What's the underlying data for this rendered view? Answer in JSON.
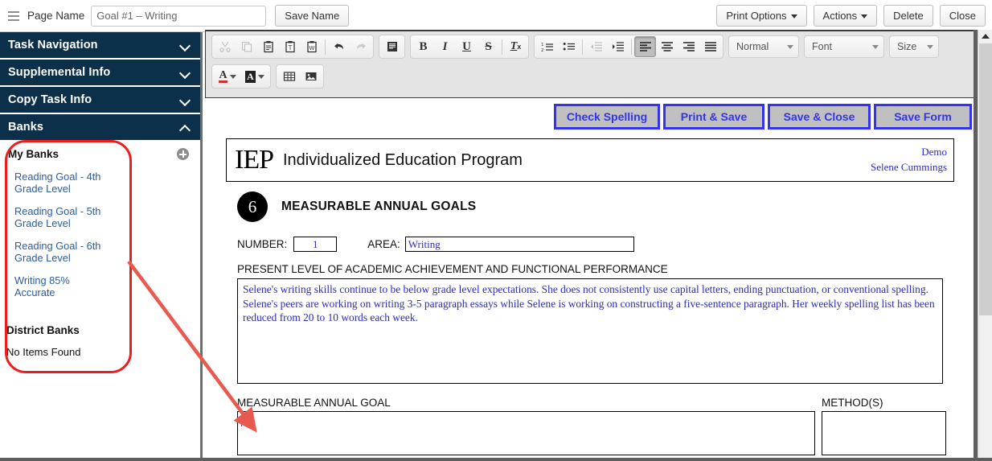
{
  "topbar": {
    "menu_icon": "hamburger-icon",
    "page_name_label": "Page Name",
    "page_name_value": "Goal #1 – Writing",
    "page_name_placeholder": "Page Name",
    "save_name_label": "Save Name",
    "print_options_label": "Print Options",
    "actions_label": "Actions",
    "delete_label": "Delete",
    "close_label": "Close"
  },
  "sidebar": {
    "sections": [
      {
        "label": "Task Navigation",
        "state": "collapsed",
        "icon": "chevron-down-icon"
      },
      {
        "label": "Supplemental Info",
        "state": "collapsed",
        "icon": "chevron-down-icon"
      },
      {
        "label": "Copy Task Info",
        "state": "collapsed",
        "icon": "chevron-down-icon"
      },
      {
        "label": "Banks",
        "state": "expanded",
        "icon": "chevron-up-icon"
      }
    ],
    "banks": {
      "my_banks_title": "My Banks",
      "add_icon": "plus-circle-icon",
      "items": [
        "Reading Goal - 4th Grade Level",
        "Reading Goal - 5th Grade Level",
        "Reading Goal - 6th Grade Level",
        "Writing 85% Accurate"
      ],
      "district_banks_title": "District Banks",
      "district_banks_empty": "No Items Found"
    }
  },
  "editor_toolbar": {
    "groups": [
      {
        "name": "clipboard",
        "buttons": [
          {
            "icon": "cut-icon",
            "label": "Cut",
            "disabled": true
          },
          {
            "icon": "copy-icon",
            "label": "Copy",
            "disabled": true
          },
          {
            "icon": "paste-icon",
            "label": "Paste",
            "disabled": false
          },
          {
            "icon": "paste-text-icon",
            "label": "Paste as plain text",
            "disabled": false
          },
          {
            "icon": "paste-word-icon",
            "label": "Paste from Word",
            "disabled": false
          },
          {
            "icon": "undo-icon",
            "label": "Undo",
            "disabled": false
          },
          {
            "icon": "redo-icon",
            "label": "Redo",
            "disabled": true
          }
        ]
      },
      {
        "name": "templates",
        "buttons": [
          {
            "icon": "templates-icon",
            "label": "Templates",
            "disabled": false
          }
        ]
      },
      {
        "name": "basic-styles",
        "buttons": [
          {
            "icon": "bold-icon",
            "label": "B",
            "disabled": false
          },
          {
            "icon": "italic-icon",
            "label": "I",
            "disabled": false
          },
          {
            "icon": "underline-icon",
            "label": "U",
            "disabled": false
          },
          {
            "icon": "strikethrough-icon",
            "label": "S",
            "disabled": false
          },
          {
            "icon": "remove-format-icon",
            "label": "Tx",
            "disabled": false
          }
        ]
      },
      {
        "name": "paragraph",
        "buttons": [
          {
            "icon": "numbered-list-icon",
            "label": "Insert/Remove Numbered List",
            "disabled": false
          },
          {
            "icon": "bulleted-list-icon",
            "label": "Insert/Remove Bulleted List",
            "disabled": false
          },
          {
            "icon": "outdent-icon",
            "label": "Decrease Indent",
            "disabled": true
          },
          {
            "icon": "indent-icon",
            "label": "Increase Indent",
            "disabled": false
          },
          {
            "icon": "align-left-icon",
            "label": "Align Left",
            "disabled": false,
            "pressed": true
          },
          {
            "icon": "align-center-icon",
            "label": "Center",
            "disabled": false
          },
          {
            "icon": "align-right-icon",
            "label": "Align Right",
            "disabled": false
          },
          {
            "icon": "justify-icon",
            "label": "Justify",
            "disabled": false
          }
        ]
      }
    ],
    "selects": [
      {
        "name": "paragraph-format",
        "value": "Normal"
      },
      {
        "name": "font-family",
        "value": "Font"
      },
      {
        "name": "font-size",
        "value": "Size"
      }
    ],
    "row2": [
      {
        "icon": "text-color-icon",
        "label": "A",
        "has_caret": true
      },
      {
        "icon": "background-color-icon",
        "label": "A",
        "has_caret": true
      },
      {
        "icon": "table-icon",
        "label": "Table"
      },
      {
        "icon": "image-icon",
        "label": "Image"
      }
    ]
  },
  "actions": {
    "check_spelling": "Check Spelling",
    "print_save": "Print & Save",
    "save_close": "Save & Close",
    "save_form": "Save Form",
    "border_color": "#3333ee",
    "background_color": "#c0c0c0"
  },
  "document": {
    "logo_mark": "IEP",
    "header_title": "Individualized Education Program",
    "district": "Demo",
    "student_name": "Selene Cummings",
    "section_number": "6",
    "section_title": "MEASURABLE ANNUAL GOALS",
    "number_label": "NUMBER:",
    "number_value": "1",
    "area_label": "AREA:",
    "area_value": "Writing",
    "present_level_label": "PRESENT LEVEL OF ACADEMIC ACHIEVEMENT AND FUNCTIONAL PERFORMANCE",
    "present_level_text": "Selene's writing skills continue to be below grade level expectations. She does not consistently use capital letters, ending punctuation, or conventional spelling. Selene's peers are working on writing 3-5 paragraph essays while Selene is working on constructing a five-sentence paragraph. Her weekly spelling list has been reduced from 20 to 10 words each week.",
    "goal_label": "MEASURABLE ANNUAL GOAL",
    "goal_value": "",
    "methods_label": "METHOD(S)",
    "methods_value": ""
  },
  "annotation": {
    "color": "#ee1c1c",
    "shape": "rounded-rectangle-and-arrow",
    "highlights": "My Banks list",
    "points_to": "Measurable Annual Goal text box"
  },
  "scrollbar": {
    "up_arrow_icon": "scroll-up-arrow-icon",
    "orientation": "vertical"
  }
}
